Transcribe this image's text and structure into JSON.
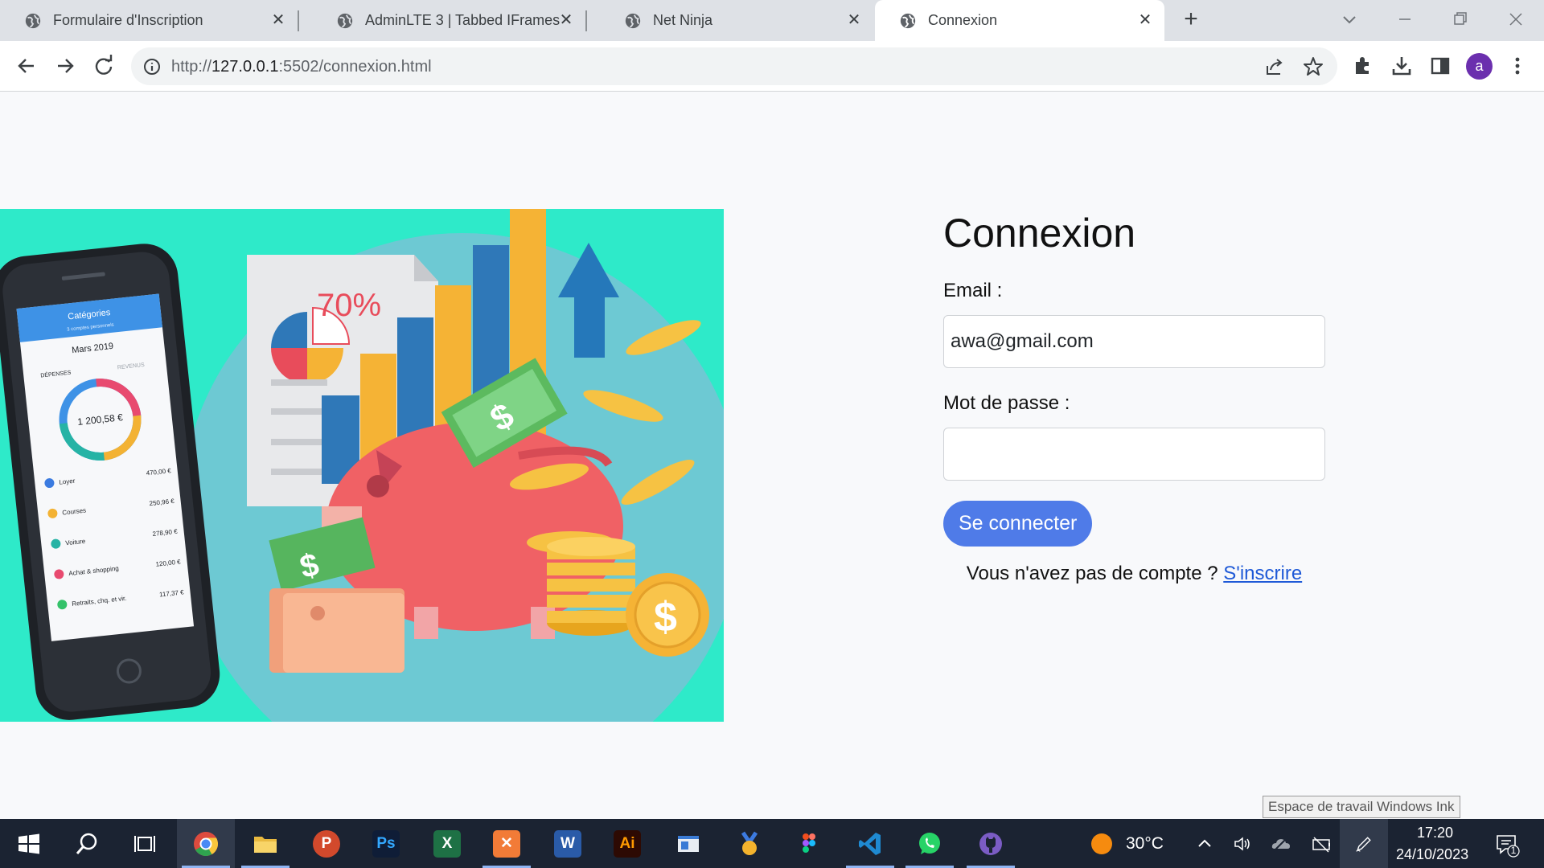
{
  "browser": {
    "tabs": [
      {
        "title": "Formulaire d'Inscription",
        "active": false
      },
      {
        "title": "AdminLTE 3 | Tabbed IFrames",
        "active": false
      },
      {
        "title": "Net Ninja",
        "active": false
      },
      {
        "title": "Connexion",
        "active": true
      }
    ],
    "url_scheme": "http://",
    "url_host": "127.0.0.1",
    "url_rest": ":5502/connexion.html",
    "profile_initial": "a",
    "profile_color": "#6b2fae"
  },
  "hero": {
    "percent_label": "70%",
    "phone": {
      "header": "Catégories",
      "subheader": "3 comptes personnels",
      "month": "Mars 2019",
      "tab_left": "DÉPENSES",
      "tab_right": "REVENUS",
      "total": "1 200,58 €",
      "rows": [
        {
          "label": "Loyer",
          "amount": "470,00 €",
          "color": "#3b7be0"
        },
        {
          "label": "Courses",
          "amount": "250,96 €",
          "color": "#f3b233"
        },
        {
          "label": "Voiture",
          "amount": "278,90 €",
          "color": "#26b3a5"
        },
        {
          "label": "Achat & shopping",
          "amount": "120,00 €",
          "color": "#e84a6f"
        },
        {
          "label": "Retraits, chq. et vir.",
          "amount": "117,37 €",
          "color": "#35c26a"
        }
      ]
    }
  },
  "login": {
    "title": "Connexion",
    "email_label": "Email :",
    "email_value": "awa@gmail.com",
    "password_label": "Mot de passe :",
    "password_value": "",
    "submit_label": "Se connecter",
    "signup_text": "Vous n'avez pas de compte ? ",
    "signup_link": "S'inscrire",
    "accent_color": "#4f7be8"
  },
  "tooltip": "Espace de travail Windows Ink",
  "taskbar": {
    "apps": [
      "start-icon",
      "search-icon",
      "task-view-icon",
      "chrome-icon",
      "file-explorer-icon",
      "powerpoint-icon",
      "photoshop-icon",
      "excel-icon",
      "xampp-icon",
      "word-icon",
      "illustrator-icon",
      "app-window-icon",
      "medal-icon",
      "figma-icon",
      "vscode-icon",
      "whatsapp-icon",
      "github-icon"
    ],
    "temperature": "30°C",
    "time": "17:20",
    "date": "24/10/2023",
    "notification_count": "1"
  }
}
